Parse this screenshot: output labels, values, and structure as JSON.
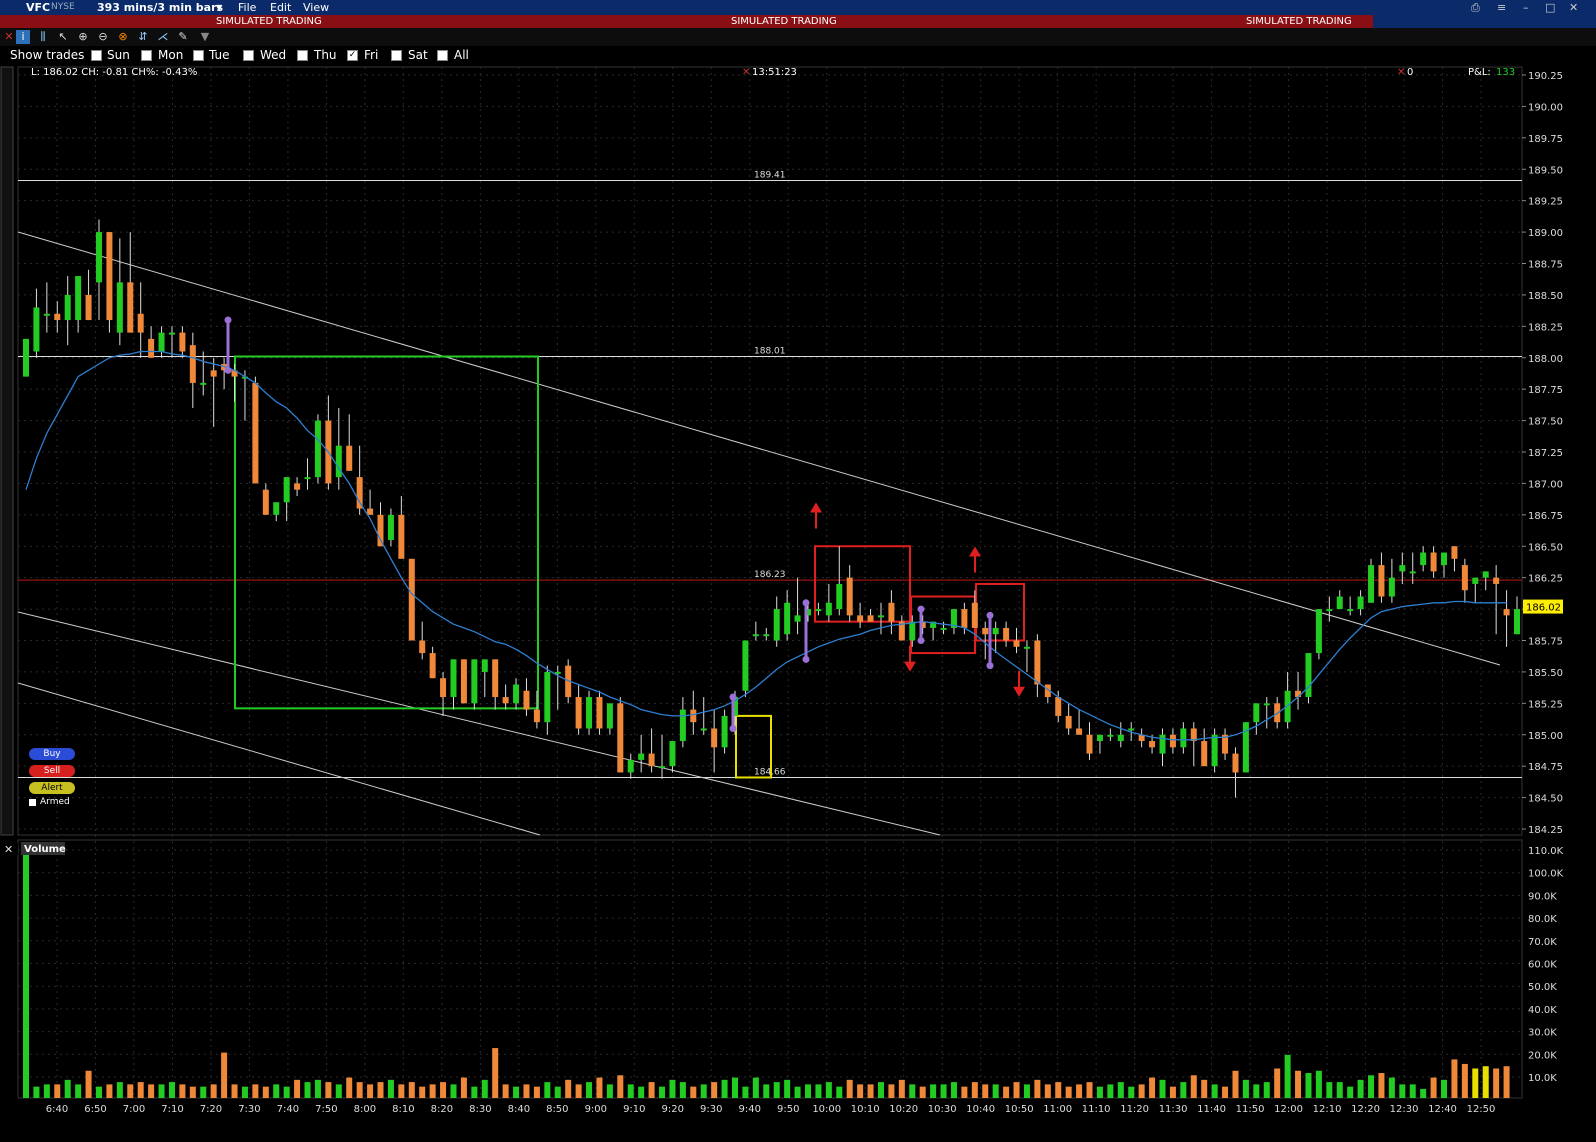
{
  "window": {
    "symbol": "VFC",
    "exchange": "NYSE",
    "timeframe": "393 mins/3 min bars",
    "menu": [
      "File",
      "Edit",
      "View"
    ],
    "banner": "SIMULATED TRADING"
  },
  "show_trades": {
    "label": "Show trades",
    "days": [
      {
        "label": "Sun",
        "checked": false
      },
      {
        "label": "Mon",
        "checked": false
      },
      {
        "label": "Tue",
        "checked": false
      },
      {
        "label": "Wed",
        "checked": false
      },
      {
        "label": "Thu",
        "checked": false
      },
      {
        "label": "Fri",
        "checked": true
      },
      {
        "label": "Sat",
        "checked": false
      },
      {
        "label": "All",
        "checked": false
      }
    ]
  },
  "info_bar": {
    "stats": "L: 186.02 CH: -0.81 CH%: -0.43%",
    "clock": "13:51:23",
    "positions": "0",
    "pnl_label": "P&L:",
    "pnl_value": "133"
  },
  "order_panel": {
    "buy": "Buy",
    "sell": "Sell",
    "alert": "Alert",
    "armed": "Armed"
  },
  "volume_panel": {
    "title": "Volume"
  },
  "colors": {
    "up": "#22cc22",
    "down": "#f0883a",
    "ma": "#2d7fd1",
    "level_red": "#c01818",
    "box_green": "#22cc22",
    "box_red": "#e02020",
    "box_yellow": "#e8e000",
    "marker_purple": "#9a6fd6",
    "last_price_bg": "#ffee00"
  },
  "chart_data": {
    "type": "candlestick",
    "price_axis": {
      "min": 184.25,
      "max": 190.25,
      "step": 0.25
    },
    "last_price": "186.02",
    "levels": [
      {
        "label": "189.41",
        "price": 189.41,
        "color": "white"
      },
      {
        "label": "188.01",
        "price": 188.01,
        "color": "white"
      },
      {
        "label": "186.23",
        "price": 186.23,
        "color": "red"
      },
      {
        "label": "184.66",
        "price": 184.66,
        "color": "white"
      }
    ],
    "time_labels": [
      "6:40",
      "6:50",
      "7:00",
      "7:10",
      "7:20",
      "7:30",
      "7:40",
      "7:50",
      "8:00",
      "8:10",
      "8:20",
      "8:30",
      "8:40",
      "8:50",
      "9:00",
      "9:10",
      "9:20",
      "9:30",
      "9:40",
      "9:50",
      "10:00",
      "10:10",
      "10:20",
      "10:30",
      "10:40",
      "10:50",
      "11:00",
      "11:10",
      "11:20",
      "11:30",
      "11:40",
      "11:50",
      "12:00",
      "12:10",
      "12:20",
      "12:30",
      "12:40",
      "12:50"
    ],
    "volume_axis": [
      "110.0K",
      "100.0K",
      "90.0K",
      "80.0K",
      "70.0K",
      "60.0K",
      "50.0K",
      "40.0K",
      "30.0K",
      "20.0K",
      "10.0K"
    ],
    "candles": [
      [
        187.85,
        188.15,
        187.85,
        188.15
      ],
      [
        188.05,
        188.55,
        188.0,
        188.4
      ],
      [
        188.35,
        188.6,
        188.2,
        188.35
      ],
      [
        188.35,
        188.45,
        188.2,
        188.3
      ],
      [
        188.3,
        188.65,
        188.1,
        188.5
      ],
      [
        188.3,
        188.65,
        188.2,
        188.65
      ],
      [
        188.5,
        188.7,
        188.3,
        188.3
      ],
      [
        188.6,
        189.1,
        188.3,
        189.0
      ],
      [
        189.0,
        189.0,
        188.2,
        188.3
      ],
      [
        188.2,
        188.95,
        188.1,
        188.6
      ],
      [
        188.6,
        189.0,
        188.2,
        188.2
      ],
      [
        188.35,
        188.6,
        188.0,
        188.2
      ],
      [
        188.15,
        188.25,
        188.0,
        188.0
      ],
      [
        188.05,
        188.25,
        188.0,
        188.2
      ],
      [
        188.2,
        188.25,
        188.0,
        188.2
      ],
      [
        188.2,
        188.25,
        188.0,
        188.05
      ],
      [
        188.1,
        188.2,
        187.6,
        187.8
      ],
      [
        187.8,
        188.05,
        187.7,
        187.8
      ],
      [
        187.9,
        188.0,
        187.45,
        187.85
      ],
      [
        187.95,
        188.0,
        187.75,
        187.9
      ],
      [
        187.9,
        187.95,
        187.65,
        187.85
      ],
      [
        187.85,
        187.9,
        187.5,
        187.85
      ],
      [
        187.8,
        187.85,
        187.0,
        187.0
      ],
      [
        186.95,
        187.0,
        186.75,
        186.75
      ],
      [
        186.75,
        186.85,
        186.7,
        186.85
      ],
      [
        186.85,
        187.05,
        186.7,
        187.05
      ],
      [
        187.0,
        187.05,
        186.9,
        186.95
      ],
      [
        187.05,
        187.2,
        186.95,
        187.05
      ],
      [
        187.05,
        187.55,
        187.0,
        187.5
      ],
      [
        187.5,
        187.7,
        186.95,
        187.0
      ],
      [
        187.05,
        187.6,
        186.95,
        187.3
      ],
      [
        187.3,
        187.55,
        187.1,
        187.1
      ],
      [
        187.05,
        187.3,
        186.75,
        186.8
      ],
      [
        186.8,
        186.95,
        186.75,
        186.75
      ],
      [
        186.75,
        186.85,
        186.5,
        186.5
      ],
      [
        186.55,
        186.8,
        186.5,
        186.75
      ],
      [
        186.75,
        186.9,
        186.55,
        186.4
      ],
      [
        186.4,
        186.4,
        185.85,
        185.75
      ],
      [
        185.75,
        185.9,
        185.6,
        185.65
      ],
      [
        185.65,
        185.7,
        185.45,
        185.45
      ],
      [
        185.45,
        185.5,
        185.15,
        185.3
      ],
      [
        185.3,
        185.6,
        185.2,
        185.6
      ],
      [
        185.6,
        185.6,
        185.25,
        185.25
      ],
      [
        185.25,
        185.6,
        185.2,
        185.6
      ],
      [
        185.5,
        185.6,
        185.3,
        185.6
      ],
      [
        185.6,
        185.6,
        185.2,
        185.3
      ],
      [
        185.3,
        185.4,
        185.2,
        185.25
      ],
      [
        185.25,
        185.45,
        185.2,
        185.4
      ],
      [
        185.35,
        185.45,
        185.15,
        185.2
      ],
      [
        185.2,
        185.35,
        185.05,
        185.1
      ],
      [
        185.1,
        185.55,
        185.0,
        185.5
      ],
      [
        185.5,
        185.55,
        185.2,
        185.5
      ],
      [
        185.55,
        185.6,
        185.25,
        185.3
      ],
      [
        185.3,
        185.4,
        185.0,
        185.05
      ],
      [
        185.05,
        185.35,
        185.0,
        185.3
      ],
      [
        185.3,
        185.35,
        185.0,
        185.05
      ],
      [
        185.05,
        185.25,
        185.0,
        185.25
      ],
      [
        185.25,
        185.3,
        184.7,
        184.7
      ],
      [
        184.7,
        184.85,
        184.65,
        184.8
      ],
      [
        184.8,
        185.0,
        184.7,
        184.85
      ],
      [
        184.85,
        185.05,
        184.7,
        184.75
      ],
      [
        184.75,
        185.0,
        184.65,
        184.75
      ],
      [
        184.75,
        184.95,
        184.7,
        184.95
      ],
      [
        184.95,
        185.3,
        184.9,
        185.2
      ],
      [
        185.2,
        185.35,
        185.0,
        185.1
      ],
      [
        185.05,
        185.3,
        185.0,
        185.05
      ],
      [
        185.05,
        185.2,
        184.7,
        184.9
      ],
      [
        184.9,
        185.2,
        184.85,
        185.15
      ],
      [
        185.15,
        185.35,
        185.0,
        185.3
      ],
      [
        185.35,
        185.75,
        185.3,
        185.75
      ],
      [
        185.8,
        185.9,
        185.75,
        185.8
      ],
      [
        185.8,
        185.85,
        185.75,
        185.8
      ],
      [
        185.75,
        186.1,
        185.7,
        186.0
      ],
      [
        185.8,
        186.15,
        185.75,
        186.05
      ],
      [
        185.9,
        186.25,
        185.8,
        185.95
      ],
      [
        185.95,
        186.05,
        185.9,
        186.0
      ],
      [
        186.0,
        186.05,
        185.95,
        186.0
      ],
      [
        185.95,
        186.2,
        185.9,
        186.05
      ],
      [
        186.0,
        186.5,
        185.95,
        186.2
      ],
      [
        186.25,
        186.35,
        185.9,
        185.95
      ],
      [
        185.95,
        186.05,
        185.85,
        185.9
      ],
      [
        185.95,
        186.0,
        185.9,
        185.9
      ],
      [
        185.95,
        186.05,
        185.8,
        185.95
      ],
      [
        186.05,
        186.15,
        185.8,
        185.9
      ],
      [
        185.9,
        185.95,
        185.75,
        185.75
      ],
      [
        185.75,
        185.95,
        185.7,
        185.9
      ],
      [
        185.9,
        185.95,
        185.8,
        185.85
      ],
      [
        185.85,
        185.9,
        185.75,
        185.9
      ],
      [
        185.85,
        185.9,
        185.8,
        185.85
      ],
      [
        185.85,
        186.0,
        185.8,
        186.0
      ],
      [
        186.0,
        186.05,
        185.8,
        185.85
      ],
      [
        186.05,
        186.15,
        185.85,
        185.85
      ],
      [
        185.85,
        185.9,
        185.6,
        185.8
      ],
      [
        185.8,
        185.9,
        185.65,
        185.85
      ],
      [
        185.85,
        185.9,
        185.7,
        185.75
      ],
      [
        185.75,
        185.85,
        185.65,
        185.7
      ],
      [
        185.7,
        185.75,
        185.5,
        185.7
      ],
      [
        185.75,
        185.8,
        185.3,
        185.4
      ],
      [
        185.4,
        185.4,
        185.25,
        185.3
      ],
      [
        185.3,
        185.35,
        185.1,
        185.15
      ],
      [
        185.15,
        185.25,
        185.0,
        185.05
      ],
      [
        185.05,
        185.2,
        185.0,
        185.0
      ],
      [
        185.0,
        185.1,
        184.8,
        184.85
      ],
      [
        184.95,
        185.0,
        184.85,
        185.0
      ],
      [
        185.0,
        185.05,
        184.95,
        185.0
      ],
      [
        184.95,
        185.1,
        184.9,
        185.0
      ],
      [
        185.05,
        185.1,
        184.95,
        185.05
      ],
      [
        185.0,
        185.05,
        184.9,
        184.95
      ],
      [
        184.95,
        185.0,
        184.85,
        184.9
      ],
      [
        184.85,
        185.05,
        184.75,
        185.0
      ],
      [
        185.0,
        185.05,
        184.85,
        184.9
      ],
      [
        184.9,
        185.1,
        184.85,
        185.05
      ],
      [
        185.05,
        185.1,
        184.75,
        184.95
      ],
      [
        184.95,
        185.05,
        184.75,
        184.75
      ],
      [
        184.75,
        185.05,
        184.7,
        185.0
      ],
      [
        185.0,
        185.05,
        184.8,
        184.85
      ],
      [
        184.85,
        184.9,
        184.5,
        184.7
      ],
      [
        184.7,
        185.1,
        184.7,
        185.1
      ],
      [
        185.1,
        185.25,
        185.0,
        185.25
      ],
      [
        185.25,
        185.3,
        185.05,
        185.25
      ],
      [
        185.25,
        185.3,
        185.05,
        185.1
      ],
      [
        185.1,
        185.5,
        185.05,
        185.35
      ],
      [
        185.35,
        185.5,
        185.2,
        185.3
      ],
      [
        185.3,
        185.65,
        185.25,
        185.65
      ],
      [
        185.65,
        186.0,
        185.6,
        186.0
      ],
      [
        186.0,
        186.1,
        185.9,
        186.0
      ],
      [
        186.0,
        186.15,
        186.0,
        186.1
      ],
      [
        186.0,
        186.1,
        185.95,
        186.0
      ],
      [
        186.0,
        186.15,
        185.95,
        186.1
      ],
      [
        186.05,
        186.4,
        186.05,
        186.35
      ],
      [
        186.35,
        186.45,
        186.05,
        186.1
      ],
      [
        186.1,
        186.4,
        186.05,
        186.25
      ],
      [
        186.3,
        186.45,
        186.2,
        186.35
      ],
      [
        186.3,
        186.45,
        186.2,
        186.3
      ],
      [
        186.35,
        186.5,
        186.3,
        186.45
      ],
      [
        186.45,
        186.5,
        186.25,
        186.3
      ],
      [
        186.35,
        186.45,
        186.25,
        186.45
      ],
      [
        186.5,
        186.5,
        186.3,
        186.4
      ],
      [
        186.35,
        186.4,
        186.05,
        186.15
      ],
      [
        186.2,
        186.25,
        186.05,
        186.25
      ],
      [
        186.25,
        186.3,
        186.15,
        186.3
      ],
      [
        186.25,
        186.35,
        185.8,
        186.2
      ],
      [
        186.0,
        186.15,
        185.7,
        185.95
      ],
      [
        185.8,
        186.1,
        185.8,
        186.0
      ]
    ],
    "volumes": [
      120,
      5,
      6,
      6,
      8,
      6,
      12,
      5,
      6,
      7,
      6,
      7,
      6,
      6,
      7,
      6,
      5,
      5,
      6,
      20,
      6,
      5,
      6,
      5,
      6,
      5,
      8,
      7,
      8,
      7,
      6,
      9,
      7,
      6,
      7,
      8,
      6,
      7,
      5,
      6,
      7,
      6,
      9,
      5,
      8,
      22,
      6,
      5,
      6,
      5,
      7,
      5,
      8,
      6,
      7,
      9,
      6,
      10,
      6,
      5,
      7,
      5,
      8,
      7,
      5,
      6,
      7,
      8,
      9,
      5,
      9,
      6,
      7,
      8,
      5,
      6,
      6,
      7,
      5,
      8,
      6,
      6,
      7,
      6,
      8,
      6,
      5,
      6,
      6,
      7,
      5,
      7,
      6,
      6,
      5,
      7,
      6,
      8,
      6,
      7,
      5,
      6,
      7,
      5,
      6,
      7,
      5,
      6,
      9,
      8,
      5,
      7,
      10,
      8,
      6,
      5,
      12,
      8,
      6,
      7,
      13,
      19,
      12,
      11,
      12,
      7,
      7,
      5,
      8,
      10,
      11,
      9,
      6,
      6,
      4,
      9,
      8,
      17,
      15,
      13,
      14,
      13,
      14
    ],
    "ma": [
      186.95,
      187.2,
      187.4,
      187.55,
      187.7,
      187.85,
      187.9,
      187.95,
      188.0,
      188.02,
      188.03,
      188.05,
      188.05,
      188.05,
      188.03,
      188.02,
      188.0,
      187.97,
      187.95,
      187.93,
      187.9,
      187.85,
      187.8,
      187.72,
      187.65,
      187.6,
      187.52,
      187.42,
      187.35,
      187.25,
      187.12,
      187.0,
      186.85,
      186.72,
      186.55,
      186.4,
      186.25,
      186.12,
      186.05,
      185.98,
      185.93,
      185.88,
      185.85,
      185.82,
      185.78,
      185.74,
      185.72,
      185.68,
      185.63,
      185.57,
      185.52,
      185.47,
      185.43,
      185.4,
      185.37,
      185.34,
      185.3,
      185.27,
      185.24,
      185.2,
      185.18,
      185.16,
      185.15,
      185.15,
      185.16,
      185.18,
      185.2,
      185.23,
      185.27,
      185.32,
      185.38,
      185.45,
      185.52,
      185.58,
      185.62,
      185.66,
      185.7,
      185.73,
      185.76,
      185.78,
      185.8,
      185.83,
      185.85,
      185.87,
      185.88,
      185.89,
      185.9,
      185.89,
      185.88,
      185.87,
      185.85,
      185.8,
      185.73,
      185.66,
      185.6,
      185.54,
      185.48,
      185.42,
      185.36,
      185.3,
      185.25,
      185.2,
      185.16,
      185.12,
      185.08,
      185.05,
      185.02,
      185.0,
      184.98,
      184.97,
      184.96,
      184.96,
      184.96,
      184.97,
      184.98,
      184.98,
      185.0,
      185.03,
      185.07,
      185.12,
      185.17,
      185.23,
      185.3,
      185.38,
      185.48,
      185.58,
      185.68,
      185.77,
      185.85,
      185.93,
      185.98,
      186.0,
      186.02,
      186.03,
      186.04,
      186.05,
      186.05,
      186.06,
      186.06,
      186.05,
      186.05,
      186.05,
      186.05
    ]
  }
}
